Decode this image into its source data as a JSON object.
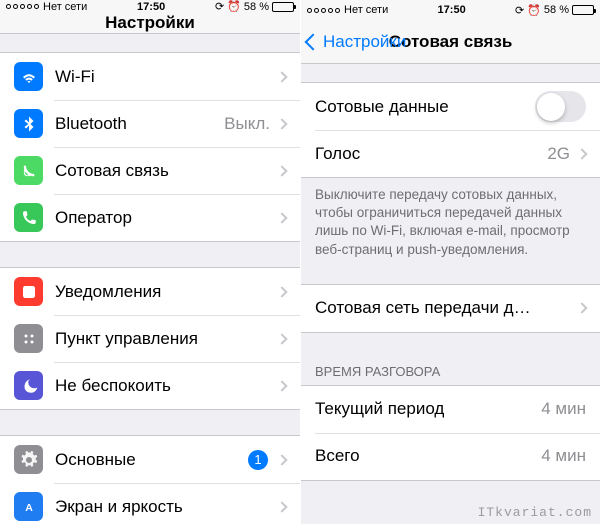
{
  "status": {
    "carrier": "Нет сети",
    "time": "17:50",
    "battery_pct": "58 %"
  },
  "left": {
    "title": "Настройки",
    "rows": {
      "wifi": {
        "label": "Wi-Fi"
      },
      "bluetooth": {
        "label": "Bluetooth",
        "value": "Выкл."
      },
      "cellular": {
        "label": "Сотовая связь"
      },
      "carrier": {
        "label": "Оператор"
      },
      "notifications": {
        "label": "Уведомления"
      },
      "control_center": {
        "label": "Пункт управления"
      },
      "dnd": {
        "label": "Не беспокоить"
      },
      "general": {
        "label": "Основные",
        "badge": "1"
      },
      "display": {
        "label": "Экран и яркость"
      }
    }
  },
  "right": {
    "back": "Настройки",
    "title": "Сотовая связь",
    "rows": {
      "cellular_data": {
        "label": "Сотовые данные"
      },
      "voice": {
        "label": "Голос",
        "value": "2G"
      },
      "network": {
        "label": "Сотовая сеть передачи д…"
      },
      "current_period": {
        "label": "Текущий период",
        "value": "4 мин"
      },
      "total": {
        "label": "Всего",
        "value": "4 мин"
      }
    },
    "explain": "Выключите передачу сотовых данных, чтобы ограничиться передачей данных лишь по Wi-Fi, включая e-mail, просмотр веб-страниц и push-уведомления.",
    "section_call_time": "ВРЕМЯ РАЗГОВОРА"
  },
  "colors": {
    "blue": "#007aff",
    "green_cell": "#4cd964",
    "green_phone": "#38c759",
    "red": "#ff3b30",
    "gray": "#8e8e93",
    "purple": "#5856d6",
    "app_blue": "#1f7cf1"
  },
  "watermark": "ITkvariat.com"
}
